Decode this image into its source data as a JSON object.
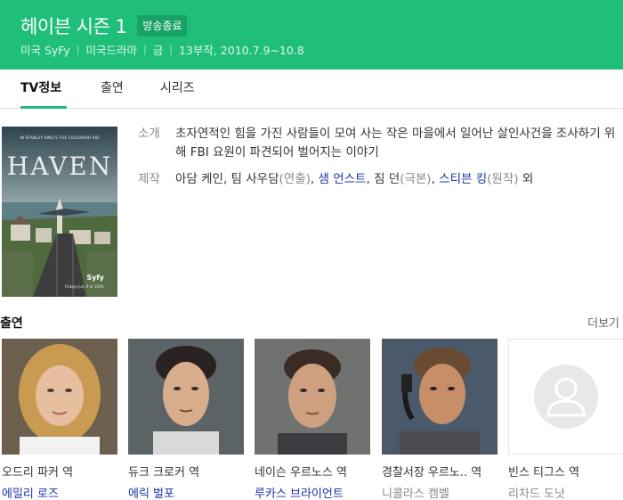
{
  "header": {
    "title": "헤이븐 시즌 1",
    "badge": "방송종료",
    "meta": [
      "미국 SyFy",
      "미국드라마",
      "금",
      "13부작, 2010.7.9~10.8"
    ]
  },
  "tabs": [
    {
      "label": "TV정보",
      "active": true
    },
    {
      "label": "출연",
      "active": false
    },
    {
      "label": "시리즈",
      "active": false
    }
  ],
  "poster": {
    "top_text": "IN STANLEY KING'S THE COLORADO KID",
    "logo": "HAVEN",
    "network": "Syfy",
    "airdate": "Fridays July 9 at 10/9c"
  },
  "info": {
    "intro_label": "소개",
    "intro_text": "초자연적인 힘을 가진 사람들이 모여 사는 작은 마을에서 일어난 살인사건을 조사하기 위해 FBI 요원이 파견되어 벌어지는 이야기",
    "prod_label": "제작",
    "prod": {
      "part1": "아담 케인, 팀 사우담",
      "part1_role": "(연출)",
      "sep1": ", ",
      "link1": "샘 언스트",
      "sep2": ", 짐 던",
      "part2_role": "(극본)",
      "sep3": ", ",
      "link2": "스티븐 킹",
      "part3_role": "(원작)",
      "suffix": " 외"
    }
  },
  "cast": {
    "title": "출연",
    "more": "더보기",
    "items": [
      {
        "role": "오드리 파커 역",
        "actor": "에밀리 로즈",
        "linked": true
      },
      {
        "role": "듀크 크로커 역",
        "actor": "에릭 벌포",
        "linked": true
      },
      {
        "role": "네이슨 우르노스 역",
        "actor": "루카스 브라이언트",
        "linked": true
      },
      {
        "role": "경찰서장 우르노.. 역",
        "actor": "니콜라스 캠벨",
        "linked": false
      },
      {
        "role": "빈스 티그스 역",
        "actor": "리차드 도낫",
        "linked": false
      }
    ]
  },
  "colors": {
    "brand": "#1fbf7a",
    "link": "#1a33a8"
  }
}
